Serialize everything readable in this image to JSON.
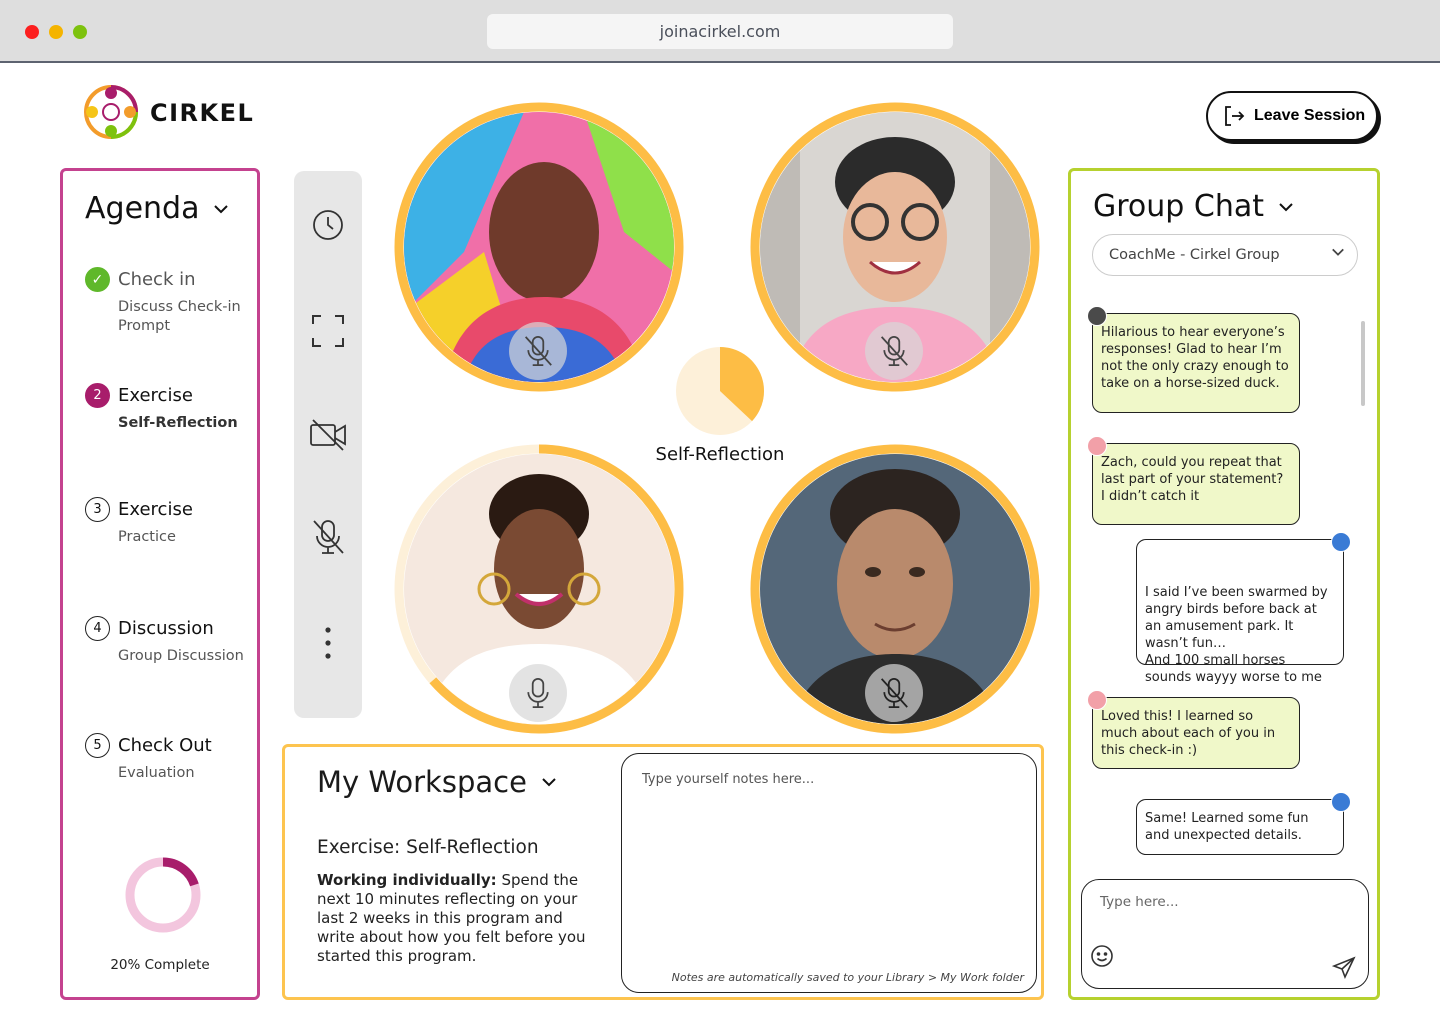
{
  "browser": {
    "url": "joinacirkel.com"
  },
  "header": {
    "brand": "CIRKEL",
    "leave_label": "Leave Session"
  },
  "agenda": {
    "title": "Agenda",
    "items": [
      {
        "num": "✓",
        "title": "Check in",
        "sub": "Discuss Check-in Prompt",
        "state": "done"
      },
      {
        "num": "2",
        "title": "Exercise",
        "sub": "Self-Reflection",
        "state": "active"
      },
      {
        "num": "3",
        "title": "Exercise",
        "sub": "Practice",
        "state": "todo"
      },
      {
        "num": "4",
        "title": "Discussion",
        "sub": "Group Discussion",
        "state": "todo"
      },
      {
        "num": "5",
        "title": "Check Out",
        "sub": "Evaluation",
        "state": "todo"
      }
    ],
    "progress": 0.2,
    "progress_label": "20% Complete"
  },
  "toolbar": {
    "icons": [
      "clock-icon",
      "fullscreen-icon",
      "camera-off-icon",
      "mic-off-icon",
      "more-icon"
    ]
  },
  "session": {
    "activity": "Self-Reflection",
    "timer_elapsed_fraction": 0.37
  },
  "participants": [
    {
      "name": "participant-1",
      "muted": true,
      "colors": [
        "#f06fa8",
        "#3db1e6",
        "#6f3a2b"
      ]
    },
    {
      "name": "participant-2",
      "muted": true,
      "colors": [
        "#d9d6d2",
        "#f7a8c5",
        "#2b2b2b"
      ]
    },
    {
      "name": "participant-3",
      "muted": false,
      "colors": [
        "#f5e8df",
        "#ffffff",
        "#4b2c1f"
      ]
    },
    {
      "name": "participant-4",
      "muted": true,
      "colors": [
        "#546779",
        "#2c2c2c",
        "#b98a6c"
      ]
    }
  ],
  "workspace": {
    "title": "My Workspace",
    "exercise": "Exercise: Self-Reflection",
    "desc_bold": "Working individually:",
    "desc_rest": " Spend the next 10 minutes reflecting on your last 2 weeks in this program and write about how you felt before you started this program.",
    "notes_placeholder": "Type yourself notes here...",
    "notes_footer": "Notes are automatically saved to your Library > My Work folder"
  },
  "chat": {
    "title": "Group Chat",
    "group": "CoachMe - Cirkel Group",
    "messages": [
      {
        "text": "Hilarious to hear everyone’s responses! Glad to hear I’m not the only crazy enough to take on a horse-sized duck.",
        "dir": "in"
      },
      {
        "text": "Zach, could you repeat that last part of your statement? I didn’t catch it",
        "dir": "in"
      },
      {
        "text": "I said I’ve been swarmed by angry birds before back at an amusement park. It wasn’t fun…\nAnd 100 small horses sounds wayyy worse to me",
        "dir": "out"
      },
      {
        "text": "Loved this! I learned so much about each of you in this check-in :)",
        "dir": "in"
      },
      {
        "text": "Same! Learned some fun and unexpected details.",
        "dir": "out"
      }
    ],
    "input_placeholder": "Type here..."
  },
  "colors": {
    "agenda": "#c4428f",
    "accent_pink": "#a81d6b",
    "workspace": "#fdc44f",
    "chat": "#b6d12f",
    "tile_ring": "#fdbd45"
  }
}
